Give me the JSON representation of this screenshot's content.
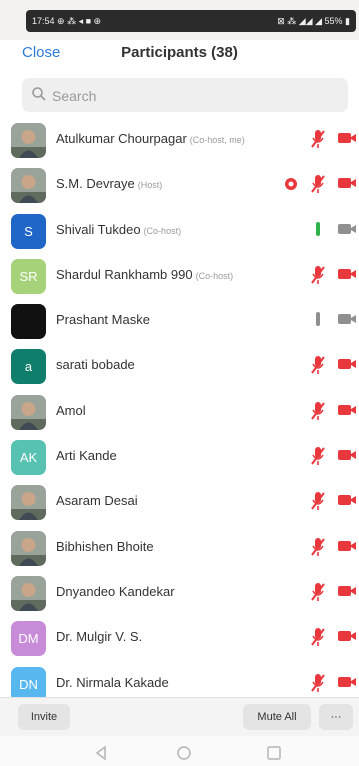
{
  "status_bar": {
    "left": "17:54 ⊕ ⁂ ◂ ■ ⊕",
    "right": "⊠ ⁂ ◢◢ ◢ 55% ▮"
  },
  "header": {
    "close_label": "Close",
    "title": "Participants (38)"
  },
  "search": {
    "placeholder": "Search"
  },
  "participants": [
    {
      "name": "Atulkumar Chourpagar",
      "role": "(Co-host, me)",
      "avatar": "photo",
      "mic": "muted",
      "cam": "off"
    },
    {
      "name": "S.M. Devraye",
      "role": "(Host)",
      "avatar": "photo",
      "mic": "muted",
      "cam": "off",
      "recording": true
    },
    {
      "name": "Shivali Tukdeo",
      "role": "(Co-host)",
      "avatar": "S",
      "avatar_color": "#1f66c7",
      "mic": "on",
      "cam": "on"
    },
    {
      "name": "Shardul Rankhamb 990",
      "role": "(Co-host)",
      "avatar": "SR",
      "avatar_color": "#a6d37a",
      "mic": "muted",
      "cam": "off"
    },
    {
      "name": "Prashant Maske",
      "role": "",
      "avatar": "",
      "avatar_color": "#111111",
      "mic": "on",
      "cam": "on"
    },
    {
      "name": "sarati bobade",
      "role": "",
      "avatar": "a",
      "avatar_color": "#107e6b",
      "mic": "muted",
      "cam": "off"
    },
    {
      "name": "Amol",
      "role": "",
      "avatar": "photo",
      "mic": "muted",
      "cam": "off"
    },
    {
      "name": "Arti Kande",
      "role": "",
      "avatar": "AK",
      "avatar_color": "#58c2b2",
      "mic": "muted",
      "cam": "off"
    },
    {
      "name": "Asaram Desai",
      "role": "",
      "avatar": "photo",
      "mic": "muted",
      "cam": "off"
    },
    {
      "name": "Bibhishen Bhoite",
      "role": "",
      "avatar": "photo",
      "mic": "muted",
      "cam": "off"
    },
    {
      "name": "Dnyandeo Kandekar",
      "role": "",
      "avatar": "photo",
      "mic": "muted",
      "cam": "off"
    },
    {
      "name": "Dr. Mulgir V. S.",
      "role": "",
      "avatar": "DM",
      "avatar_color": "#c88bd8",
      "mic": "muted",
      "cam": "off"
    },
    {
      "name": "Dr. Nirmala Kakade",
      "role": "",
      "avatar": "DN",
      "avatar_color": "#58b7ef",
      "mic": "muted",
      "cam": "off"
    }
  ],
  "footer": {
    "invite_label": "Invite",
    "mute_all_label": "Mute All",
    "more_label": "···"
  },
  "colors": {
    "accent": "#2d7bd8",
    "muted": "#e8383d",
    "active_mic": "#2fb24a",
    "inactive": "#8f8f8f"
  }
}
